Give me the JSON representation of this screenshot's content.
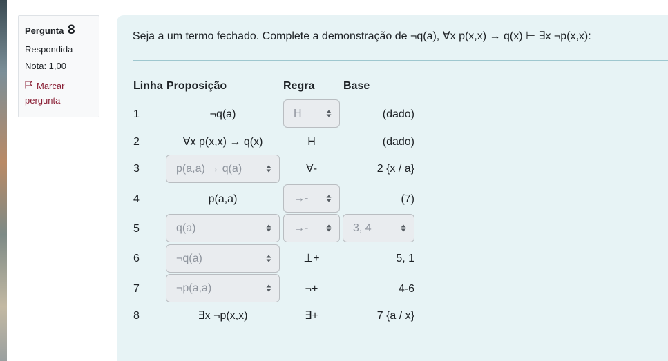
{
  "question_info": {
    "label": "Pergunta",
    "number": "8",
    "status": "Respondida",
    "grade": "Nota: 1,00",
    "flag_label": "Marcar pergunta"
  },
  "question": {
    "text": "Seja a um termo fechado. Complete a demonstração de ¬q(a), ∀x p(x,x) → q(x) ⊢ ∃x ¬p(x,x):"
  },
  "table": {
    "headers": {
      "line": "Linha",
      "proposition": "Proposição",
      "rule": "Regra",
      "base": "Base"
    },
    "rows": [
      {
        "line": "1",
        "proposition": "¬q(a)",
        "rule": "H",
        "base": "(dado)"
      },
      {
        "line": "2",
        "proposition": "∀x p(x,x) → q(x)",
        "rule": "H",
        "base": "(dado)"
      },
      {
        "line": "3",
        "proposition": "p(a,a) → q(a)",
        "rule": "∀-",
        "base": "2 {x / a}"
      },
      {
        "line": "4",
        "proposition": "p(a,a)",
        "rule": "→-",
        "base": "(7)"
      },
      {
        "line": "5",
        "proposition": "q(a)",
        "rule": "→-",
        "base": "3, 4"
      },
      {
        "line": "6",
        "proposition": "¬q(a)",
        "rule": "⊥+",
        "base": "5, 1"
      },
      {
        "line": "7",
        "proposition": "¬p(a,a)",
        "rule": "¬+",
        "base": "4-6"
      },
      {
        "line": "8",
        "proposition": "∃x ¬p(x,x)",
        "rule": "∃+",
        "base": "7 {a / x}"
      }
    ]
  }
}
